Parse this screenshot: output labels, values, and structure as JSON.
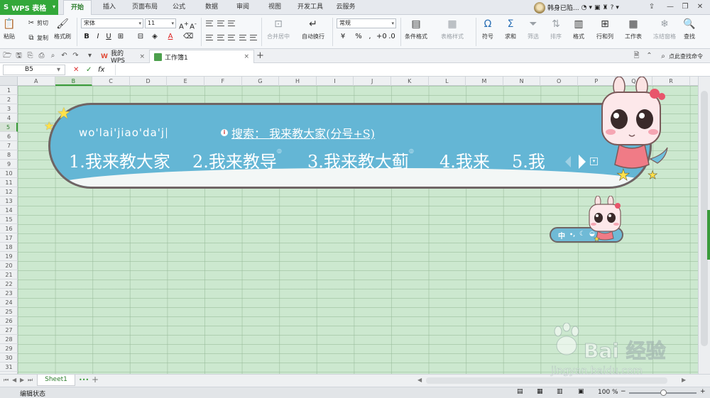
{
  "app": {
    "name": "WPS 表格"
  },
  "ribbon_tabs": [
    "开始",
    "插入",
    "页面布局",
    "公式",
    "数据",
    "审阅",
    "视图",
    "开发工具",
    "云服务"
  ],
  "active_tab": "开始",
  "user": {
    "name": "韩身已陷..."
  },
  "toolbar": {
    "paste": "粘贴",
    "cut": "剪切",
    "copy": "复制",
    "format_painter": "格式刷",
    "font_name": "宋体",
    "font_size": "11",
    "merge_center": "合并居中",
    "wrap_text": "自动换行",
    "number_format": "常规",
    "conditional_format": "条件格式",
    "table_style": "表格样式",
    "symbol": "符号",
    "sum": "求和",
    "filter": "筛选",
    "sort": "排序",
    "format": "格式",
    "rows_cols": "行和列",
    "worksheet": "工作表",
    "freeze": "冻结窗格",
    "find": "查找",
    "find_command": "点此查找命令"
  },
  "doc_tabs": [
    {
      "label": "我的WPS"
    },
    {
      "label": "工作簿1"
    }
  ],
  "formula_bar": {
    "cell_ref": "B5",
    "fx": "fx"
  },
  "columns": [
    "A",
    "B",
    "C",
    "D",
    "E",
    "F",
    "G",
    "H",
    "I",
    "J",
    "K",
    "L",
    "M",
    "N",
    "O",
    "P",
    "Q",
    "R"
  ],
  "selected_column": "B",
  "rows": [
    "1",
    "2",
    "3",
    "4",
    "5",
    "6",
    "7",
    "8",
    "9",
    "10",
    "11",
    "12",
    "13",
    "14",
    "15",
    "16",
    "17",
    "18",
    "19",
    "20",
    "21",
    "22",
    "23",
    "24",
    "25",
    "26",
    "27",
    "28",
    "29",
    "30",
    "31"
  ],
  "selected_row": "5",
  "sheet_tab": "Sheet1",
  "status": {
    "mode": "编辑状态",
    "zoom": "100 %"
  },
  "ime": {
    "pinyin": "wo'lai'jiao'da'j",
    "search_label": "搜索： 我来教大家(分号+S)",
    "candidates": [
      {
        "label": "1.我来教大家",
        "mark": ""
      },
      {
        "label": "2.我来教导",
        "mark": "◎"
      },
      {
        "label": "3.我来教大蓟",
        "mark": "◎"
      },
      {
        "label": "4.我来",
        "mark": ""
      },
      {
        "label": "5.我",
        "mark": ""
      }
    ],
    "mini_bar_text": "中"
  },
  "watermark": {
    "brand": "Bai 经验",
    "url": "jingyan.baidu.com"
  },
  "colors": {
    "brand_green": "#33a83a",
    "grid_bg": "#cce8cf",
    "ime_blue": "#64b6d5"
  }
}
